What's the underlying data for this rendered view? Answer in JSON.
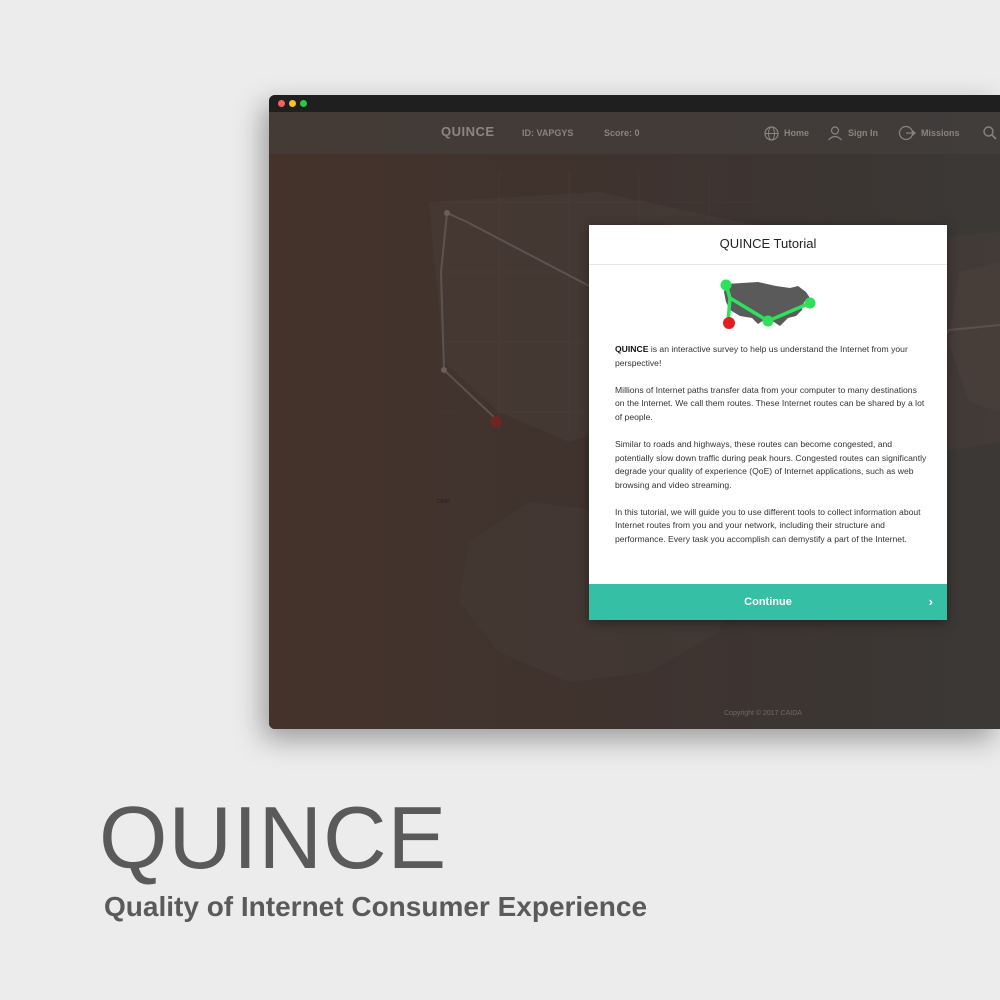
{
  "header": {
    "brand": "QUINCE",
    "id_text": "ID: VAPGYS",
    "score_text": "Score: 0",
    "nav": [
      {
        "label": "Home",
        "icon": "globe-icon"
      },
      {
        "label": "Sign In",
        "icon": "user-icon"
      },
      {
        "label": "Missions",
        "icon": "missions-icon"
      },
      {
        "label": "",
        "icon": "search-icon"
      }
    ]
  },
  "map": {
    "marker_label": "DENT",
    "copyright": "Copyright © 2017 CAIDA"
  },
  "modal": {
    "title": "QUINCE Tutorial",
    "illustration_icon": "us-map-route-icon",
    "intro_bold": "QUINCE",
    "intro_rest": " is an interactive survey to help us understand the Internet from your perspective!",
    "paragraphs": [
      "Millions of Internet paths transfer data from your computer to many destinations on the Internet. We call them routes. These Internet routes can be shared by a lot of people.",
      "Similar to roads and highways, these routes can become congested, and potentially slow down traffic during peak hours. Congested routes can significantly degrade your quality of experience (QoE) of Internet applications, such as web browsing and video streaming.",
      "In this tutorial, we will guide you to use different tools to collect information about Internet routes from you and your network, including their structure and performance. Every task you accomplish can demystify a part of the Internet."
    ],
    "continue_label": "Continue",
    "continue_icon": "›"
  },
  "poster": {
    "title": "QUINCE",
    "subtitle": "Quality of Internet Consumer Experience"
  },
  "colors": {
    "accent": "#35bfa4",
    "route_green": "#2ee05a",
    "route_red": "#e02020",
    "text_gray": "#5a5a5a"
  }
}
